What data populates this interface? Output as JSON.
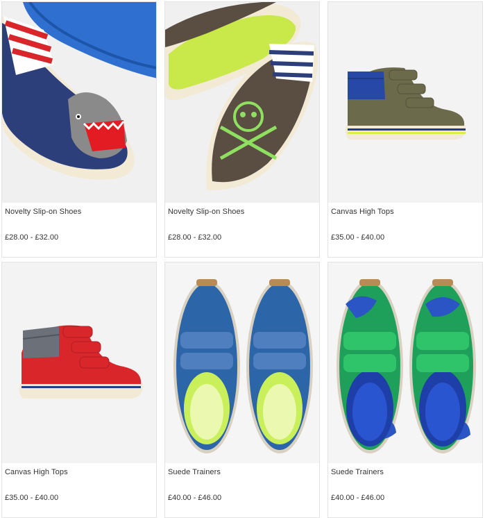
{
  "products": [
    {
      "name": "Novelty Slip-on Shoes",
      "price": "£28.00 - £32.00",
      "image_icon": "shark-slip-on-shoe"
    },
    {
      "name": "Novelty Slip-on Shoes",
      "price": "£28.00 - £32.00",
      "image_icon": "skull-slip-on-shoe"
    },
    {
      "name": "Canvas High Tops",
      "price": "£35.00 - £40.00",
      "image_icon": "khaki-high-top-shoe"
    },
    {
      "name": "Canvas High Tops",
      "price": "£35.00 - £40.00",
      "image_icon": "red-high-top-shoe"
    },
    {
      "name": "Suede Trainers",
      "price": "£40.00 - £46.00",
      "image_icon": "blue-trainers"
    },
    {
      "name": "Suede Trainers",
      "price": "£40.00 - £46.00",
      "image_icon": "green-camo-trainers"
    }
  ],
  "colors": {
    "navy": "#2d3f7a",
    "khaki": "#6b6a4a",
    "brown": "#5a4d42",
    "red": "#d9262b",
    "lime": "#c9e84a",
    "blue_sole": "#2f77d6",
    "sole_cream": "#f3ead6"
  }
}
